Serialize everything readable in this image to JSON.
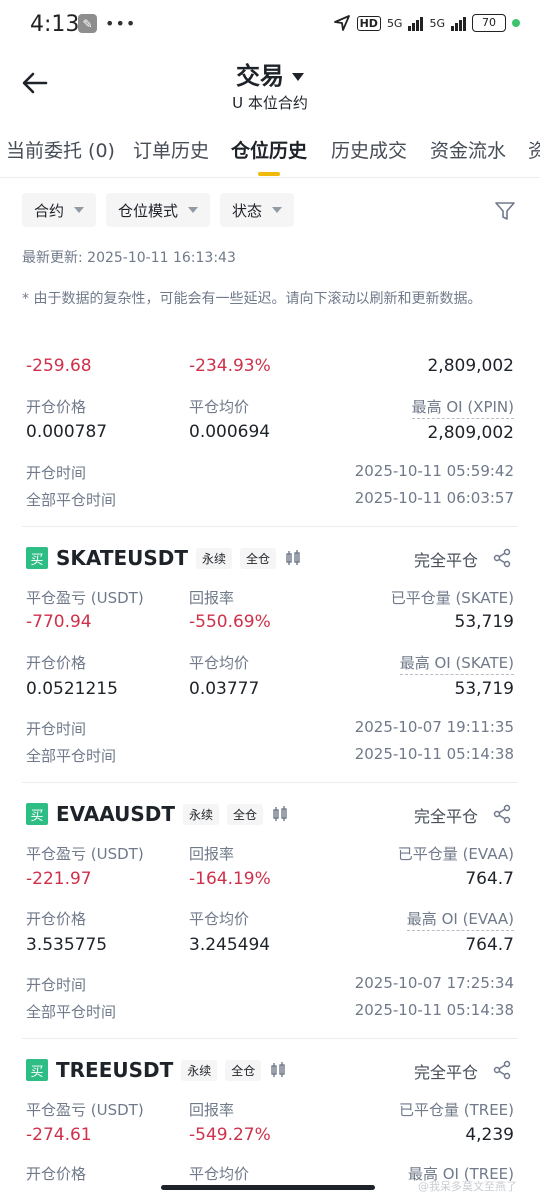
{
  "status_bar": {
    "time": "4:13",
    "dots": "•••",
    "hd": "HD",
    "net1": "5G",
    "net2": "5G",
    "battery": "70"
  },
  "header": {
    "title": "交易",
    "subtitle": "U 本位合约"
  },
  "tabs": [
    "当前委托 (0)",
    "订单历史",
    "仓位历史",
    "历史成交",
    "资金流水",
    "资"
  ],
  "filters": {
    "contract": "合约",
    "position_mode": "仓位模式",
    "status": "状态"
  },
  "last_update": "最新更新: 2025-10-11 16:13:43",
  "note": "* 由于数据的复杂性，可能会有一些延迟。请向下滚动以刷新和更新数据。",
  "partial_card": {
    "pnl": "-259.68",
    "roi": "-234.93%",
    "closed_qty": "2,809,002",
    "open_price_label": "开仓价格",
    "open_price": "0.000787",
    "avg_close_label": "平仓均价",
    "avg_close": "0.000694",
    "max_oi_label": "最高 OI (XPIN)",
    "max_oi": "2,809,002",
    "open_time_label": "开仓时间",
    "open_time": "2025-10-11 05:59:42",
    "close_time_label": "全部平仓时间",
    "close_time": "2025-10-11 06:03:57"
  },
  "positions": [
    {
      "side": "买",
      "symbol": "SKATEUSDT",
      "type_tag": "永续",
      "margin_tag": "全仓",
      "status": "完全平仓",
      "pnl_label": "平仓盈亏 (USDT)",
      "pnl": "-770.94",
      "roi_label": "回报率",
      "roi": "-550.69%",
      "closed_qty_label": "已平仓量 (SKATE)",
      "closed_qty": "53,719",
      "open_price_label": "开仓价格",
      "open_price": "0.0521215",
      "avg_close_label": "平仓均价",
      "avg_close": "0.03777",
      "max_oi_label": "最高 OI (SKATE)",
      "max_oi": "53,719",
      "open_time_label": "开仓时间",
      "open_time": "2025-10-07 19:11:35",
      "close_time_label": "全部平仓时间",
      "close_time": "2025-10-11 05:14:38"
    },
    {
      "side": "买",
      "symbol": "EVAAUSDT",
      "type_tag": "永续",
      "margin_tag": "全仓",
      "status": "完全平仓",
      "pnl_label": "平仓盈亏 (USDT)",
      "pnl": "-221.97",
      "roi_label": "回报率",
      "roi": "-164.19%",
      "closed_qty_label": "已平仓量 (EVAA)",
      "closed_qty": "764.7",
      "open_price_label": "开仓价格",
      "open_price": "3.535775",
      "avg_close_label": "平仓均价",
      "avg_close": "3.245494",
      "max_oi_label": "最高 OI (EVAA)",
      "max_oi": "764.7",
      "open_time_label": "开仓时间",
      "open_time": "2025-10-07 17:25:34",
      "close_time_label": "全部平仓时间",
      "close_time": "2025-10-11 05:14:38"
    },
    {
      "side": "买",
      "symbol": "TREEUSDT",
      "type_tag": "永续",
      "margin_tag": "全仓",
      "status": "完全平仓",
      "pnl_label": "平仓盈亏 (USDT)",
      "pnl": "-274.61",
      "roi_label": "回报率",
      "roi": "-549.27%",
      "closed_qty_label": "已平仓量 (TREE)",
      "closed_qty": "4,239",
      "open_price_label": "开仓价格",
      "avg_close_label": "平仓均价",
      "max_oi_label": "最高 OI (TREE)"
    }
  ],
  "watermark": "@我呆多莫文至燕了"
}
